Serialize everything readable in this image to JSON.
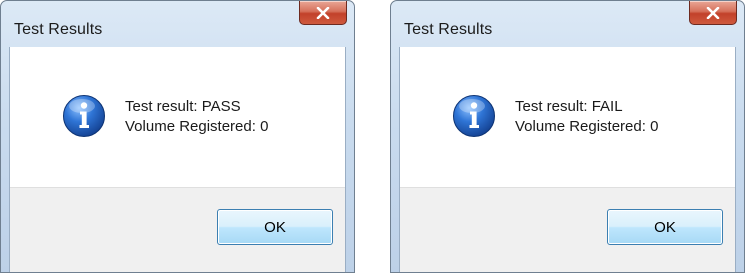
{
  "dialogs": [
    {
      "title": "Test Results",
      "close_glyph": "X",
      "icon": "information-icon",
      "message_line1": "Test result: PASS",
      "message_line2": "Volume Registered: 0",
      "ok_label": "OK"
    },
    {
      "title": "Test Results",
      "close_glyph": "X",
      "icon": "information-icon",
      "message_line1": "Test result: FAIL",
      "message_line2": "Volume Registered: 0",
      "ok_label": "OK"
    }
  ],
  "colors": {
    "window_frame": "#c9dbee",
    "close_button": "#c2412a",
    "info_icon": "#1f5fb4",
    "footer": "#f0f0f0",
    "ok_button_border": "#3c7fb1"
  }
}
